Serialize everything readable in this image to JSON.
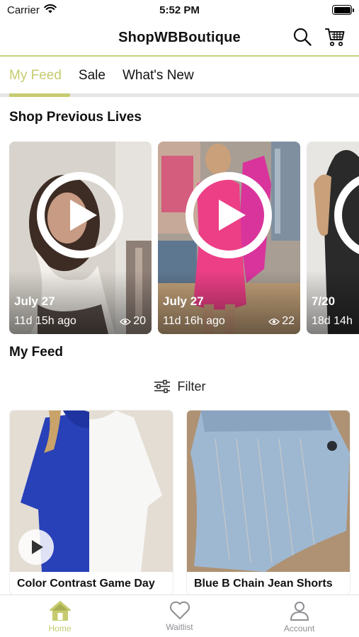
{
  "status": {
    "carrier": "Carrier",
    "time": "5:52 PM"
  },
  "header": {
    "title": "ShopWBBoutique"
  },
  "tabs": [
    {
      "label": "My Feed"
    },
    {
      "label": "Sale"
    },
    {
      "label": "What's New"
    }
  ],
  "lives": {
    "title": "Shop Previous Lives",
    "items": [
      {
        "date": "July 27",
        "ago": "11d 15h ago",
        "views": "20"
      },
      {
        "date": "July 27",
        "ago": "11d 16h ago",
        "views": "22"
      },
      {
        "date": "7/20",
        "ago": "18d 14h",
        "views": ""
      }
    ]
  },
  "feed": {
    "title": "My Feed",
    "filter_label": "Filter",
    "products": [
      {
        "name": "Color Contrast Game Day"
      },
      {
        "name": "Blue B Chain Jean Shorts"
      }
    ]
  },
  "bottom_nav": [
    {
      "label": "Home"
    },
    {
      "label": "Waitlist"
    },
    {
      "label": "Account"
    }
  ],
  "colors": {
    "accent": "#c6cb6f",
    "divider": "#c9cf7c"
  }
}
